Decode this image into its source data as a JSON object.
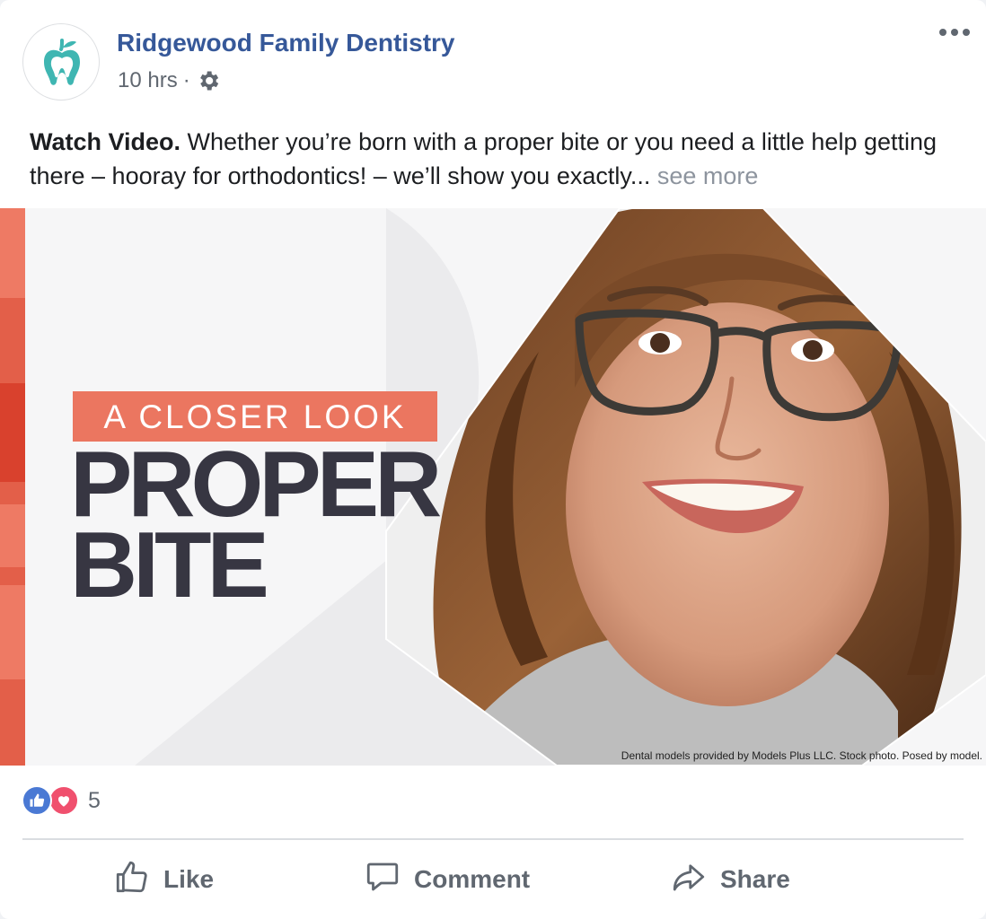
{
  "post": {
    "page_name": "Ridgewood Family Dentistry",
    "time": "10 hrs",
    "separator": "·",
    "privacy_icon": "gear-icon",
    "text_bold": "Watch Video.",
    "text_body": " Whether you’re born with a proper bite or you need a little help getting there – hooray for orthodontics! – we’ll show you exactly...",
    "see_more": "see more"
  },
  "media": {
    "headline_small": "A CLOSER LOOK",
    "headline_line1": "PROPER",
    "headline_line2": "BITE",
    "caption": "Dental models provided by Models Plus LLC. Stock photo. Posed by model."
  },
  "reactions": {
    "count": "5",
    "types": [
      "like",
      "love"
    ]
  },
  "actions": {
    "like": "Like",
    "comment": "Comment",
    "share": "Share"
  },
  "colors": {
    "brand_link": "#365899",
    "accent_orange": "#eb7660",
    "headline_dark": "#373642",
    "tooth_teal": "#3fb6b2",
    "like_blue": "#4a79d4",
    "love_red": "#f0506e"
  }
}
